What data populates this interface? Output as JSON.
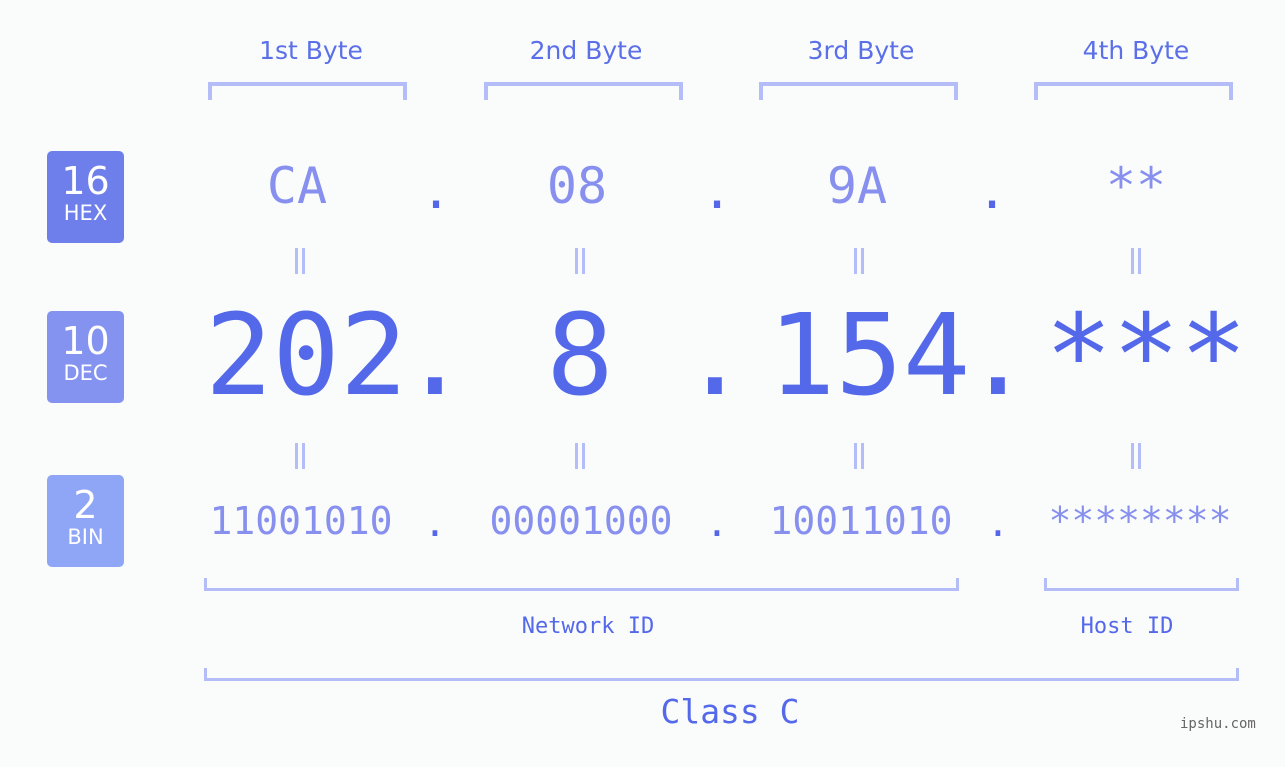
{
  "badges": {
    "hex": {
      "num": "16",
      "label": "HEX",
      "color": "#6e7feb"
    },
    "dec": {
      "num": "10",
      "label": "DEC",
      "color": "#8493f0"
    },
    "bin": {
      "num": "2",
      "label": "BIN",
      "color": "#8fa5f6"
    }
  },
  "byte_headers": [
    "1st Byte",
    "2nd Byte",
    "3rd Byte",
    "4th Byte"
  ],
  "hex": [
    "CA",
    "08",
    "9A",
    "**"
  ],
  "dec": [
    "202",
    "8",
    "154",
    "***"
  ],
  "bin": [
    "11001010",
    "00001000",
    "10011010",
    "********"
  ],
  "separator": ".",
  "network_id_label": "Network ID",
  "host_id_label": "Host ID",
  "class_label": "Class C",
  "watermark": "ipshu.com",
  "colors": {
    "primary": "#5468ea",
    "light": "#8790ee",
    "bracket": "#b4bdf7",
    "background": "#fafcfb"
  }
}
